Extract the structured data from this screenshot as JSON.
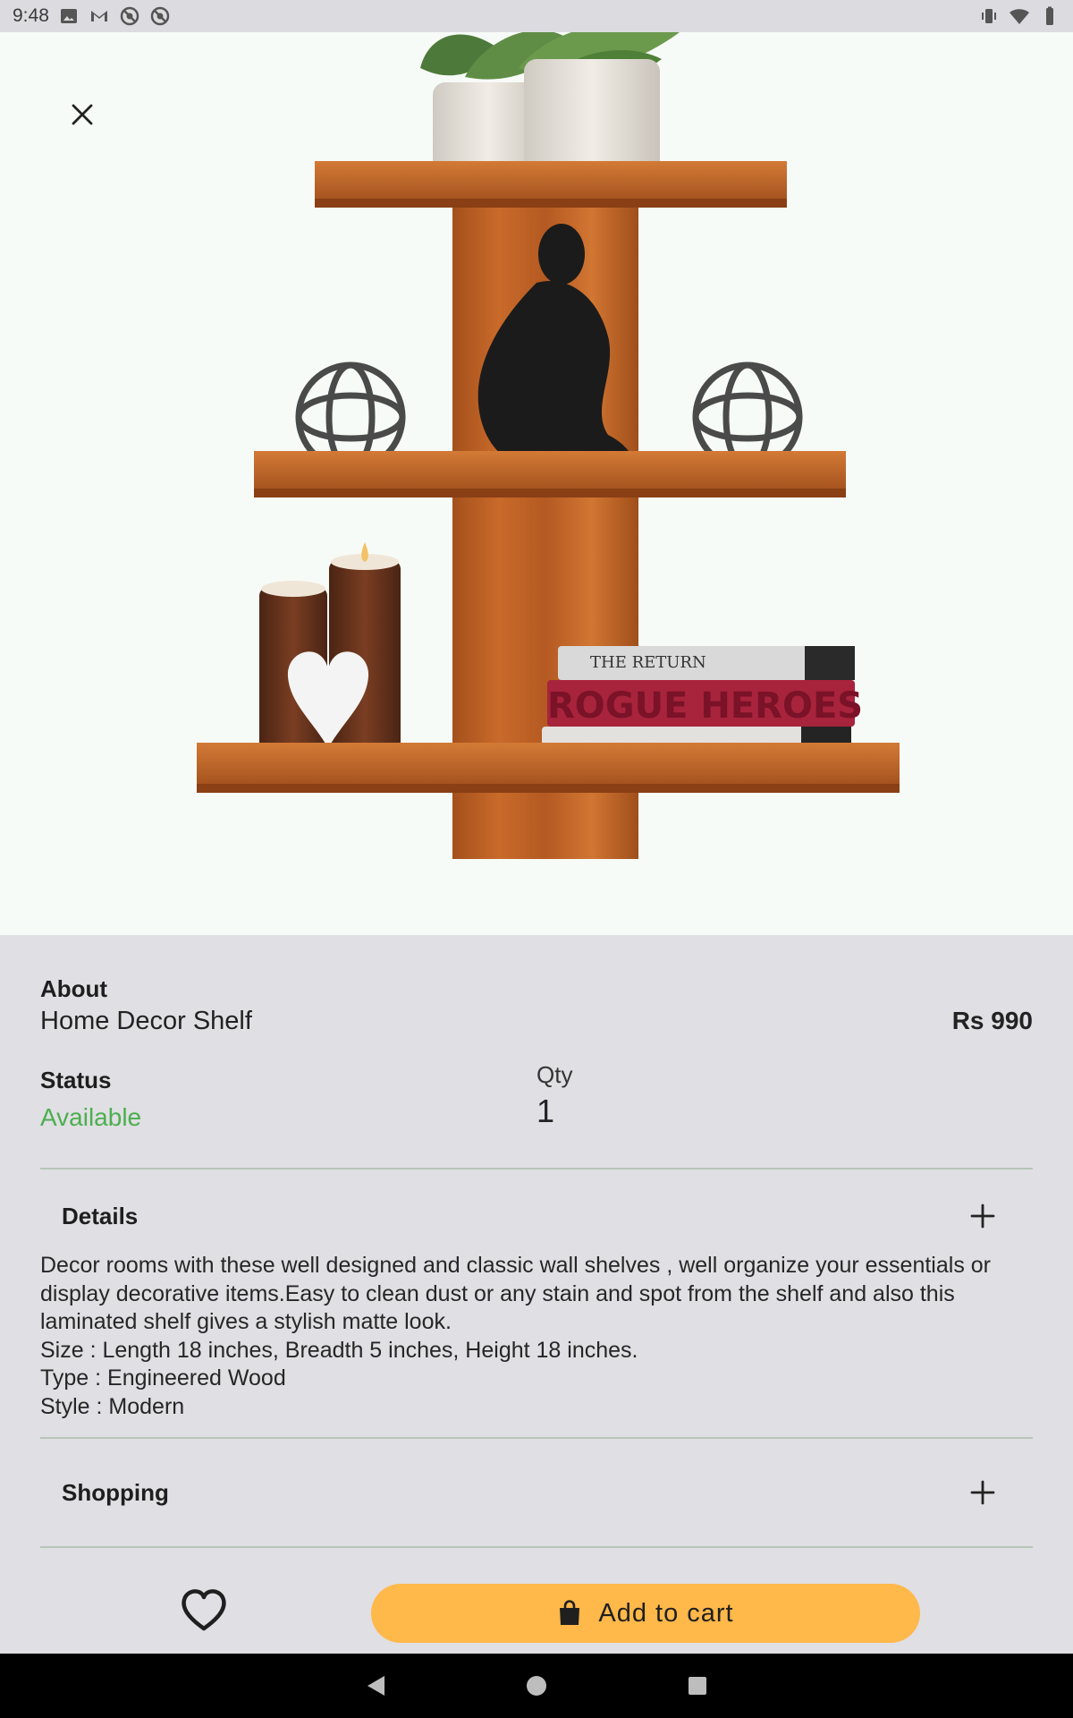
{
  "status_bar": {
    "time": "9:48",
    "left_icons": [
      "image-icon",
      "gmail-icon",
      "sync-icon",
      "sync-icon"
    ],
    "right_icons": [
      "vibrate-icon",
      "wifi-icon",
      "battery-icon"
    ]
  },
  "hero": {
    "image_alt": "Home Decor Shelf product image"
  },
  "product": {
    "about_label": "About",
    "name": "Home Decor Shelf",
    "price": "Rs 990",
    "status_label": "Status",
    "status_value": "Available",
    "qty_label": "Qty",
    "qty_value": "1"
  },
  "sections": {
    "details_title": "Details",
    "details_text": "    Decor rooms with these well designed and classic wall shelves , well organize your essentials or display decorative items.Easy to clean dust or any stain and spot from the shelf and also this laminated shelf gives a stylish matte look.\nSize : Length 18 inches, Breadth 5 inches, Height 18 inches.\n Type : Engineered Wood\n Style : Modern",
    "shopping_title": "Shopping"
  },
  "actions": {
    "add_to_cart_label": "Add to cart"
  },
  "colors": {
    "accent": "#ffb84a",
    "available": "#4caf50",
    "background": "#e0dfe3",
    "hero_background": "#f7fbf7"
  }
}
